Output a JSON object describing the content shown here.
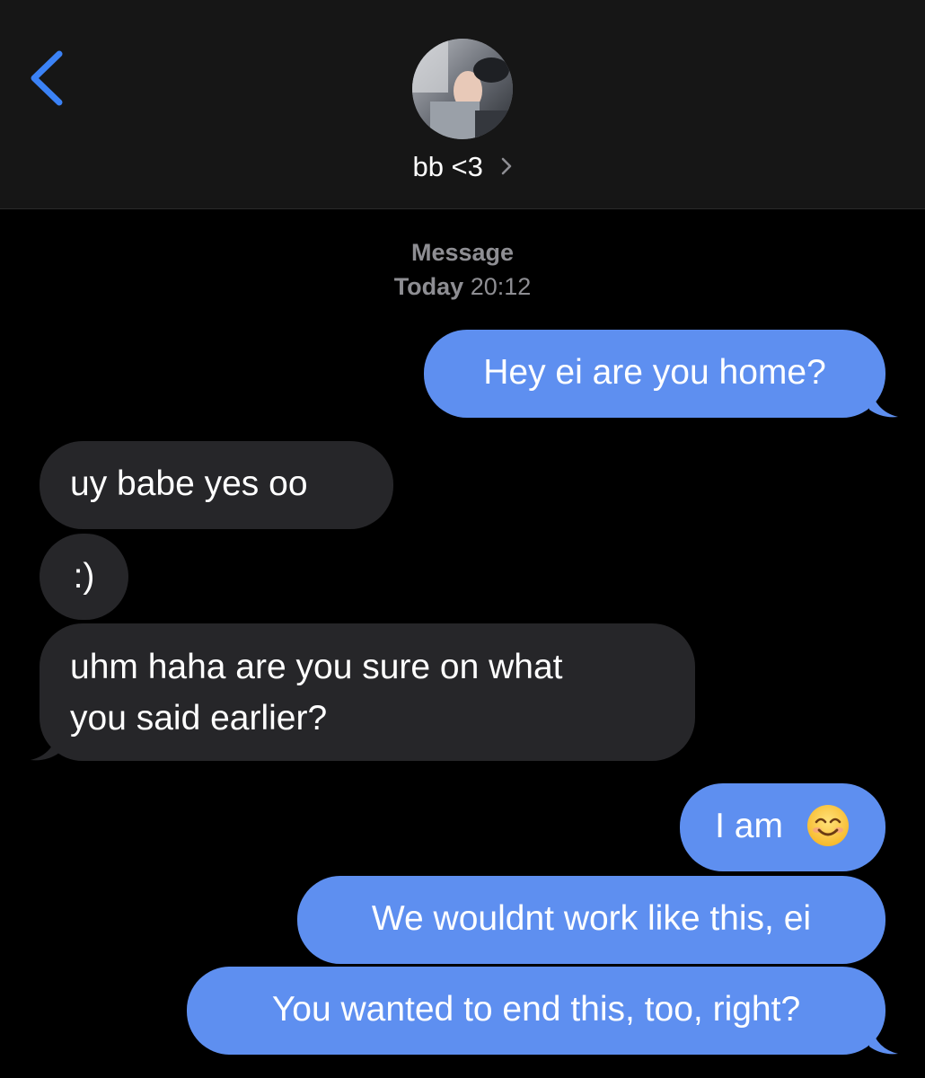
{
  "header": {
    "contact_name": "bb <3"
  },
  "thread": {
    "service_label": "Message",
    "day_label": "Today",
    "time_label": "20:12"
  },
  "messages": [
    {
      "direction": "sent",
      "text": "Hey ei are you home?"
    },
    {
      "direction": "received",
      "text": "uy babe yes oo"
    },
    {
      "direction": "received",
      "text": ":)"
    },
    {
      "direction": "received",
      "lines": [
        "uhm haha are you sure on what",
        "you said earlier?"
      ]
    },
    {
      "direction": "sent",
      "text": "I am",
      "emoji": "smiling-face-emoji"
    },
    {
      "direction": "sent",
      "text": "We wouldnt work like this, ei"
    },
    {
      "direction": "sent",
      "text": "You wanted to end this, too, right?"
    }
  ],
  "colors": {
    "sent_bubble": "#5e8ff0",
    "received_bubble": "#262629",
    "accent": "#3b82f6",
    "meta_text": "#8e8e93"
  }
}
